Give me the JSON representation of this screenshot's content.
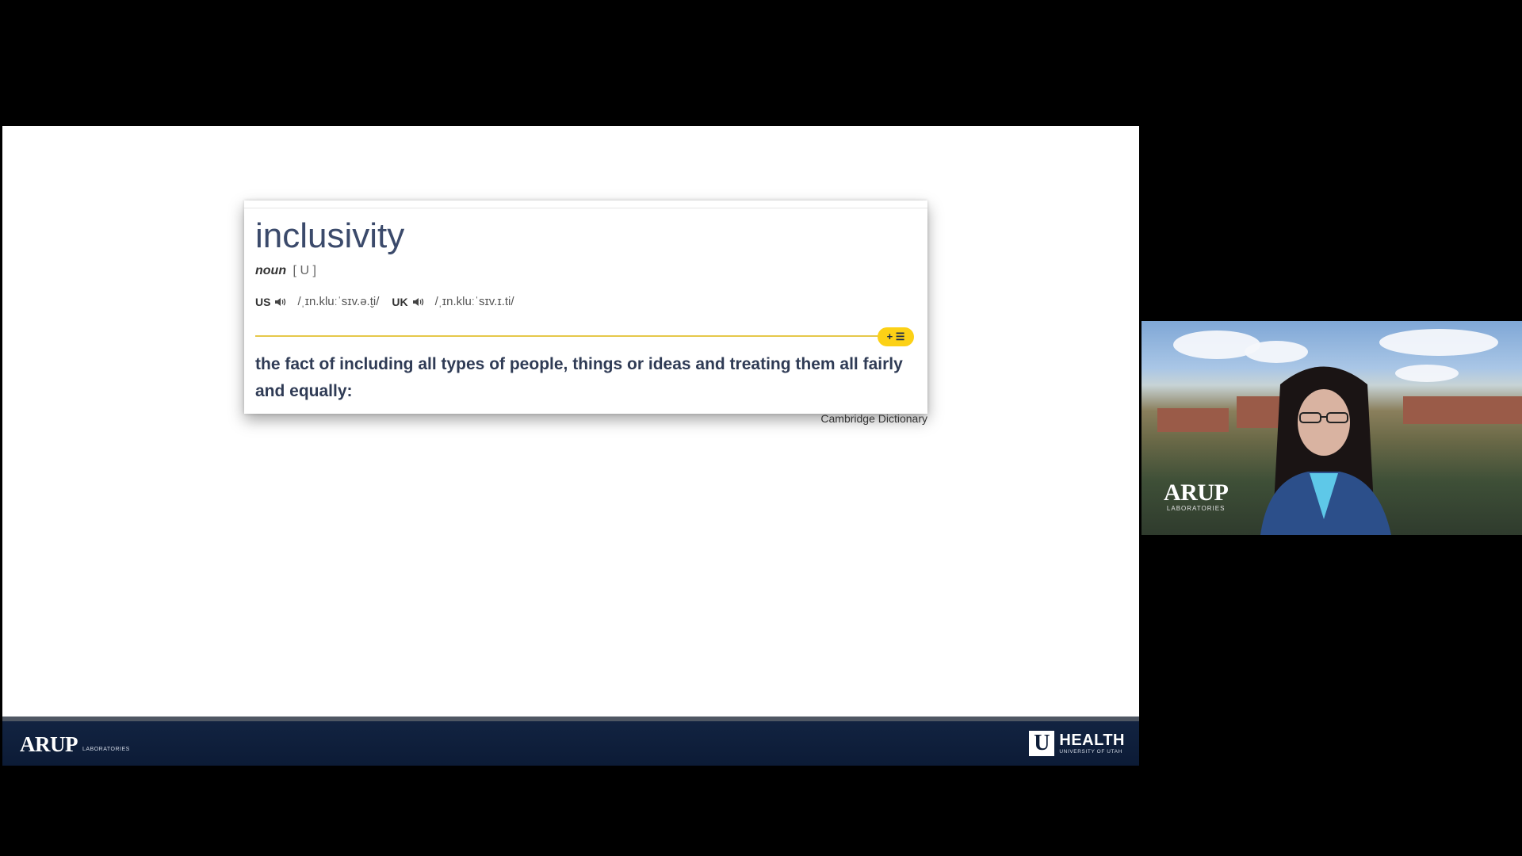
{
  "slide": {
    "card": {
      "headword": "inclusivity",
      "pos": "noun",
      "grammar": "[ U ]",
      "us_label": "US",
      "us_ipa": "/ˌɪn.kluːˈsɪv.ə.t̬i/",
      "uk_label": "UK",
      "uk_ipa": "/ˌɪn.kluːˈsɪv.ɪ.ti/",
      "badge": "+ ☰",
      "definition": "the fact of including all types of people, things or ideas and treating them all fairly and equally:"
    },
    "source": "Cambridge Dictionary",
    "footer": {
      "left_logo": "ARUP",
      "left_logo_sub": "LABORATORIES",
      "right_logo_mark": "U",
      "right_logo_title": "HEALTH",
      "right_logo_sub": "UNIVERSITY OF UTAH"
    }
  },
  "webcam": {
    "logo": "ARUP",
    "logo_sub": "LABORATORIES"
  },
  "colors": {
    "footer_navy": "#0c1b36",
    "rule_yellow": "#e6c84a",
    "badge_yellow": "#fcd116",
    "headword_color": "#3b4a6b"
  }
}
